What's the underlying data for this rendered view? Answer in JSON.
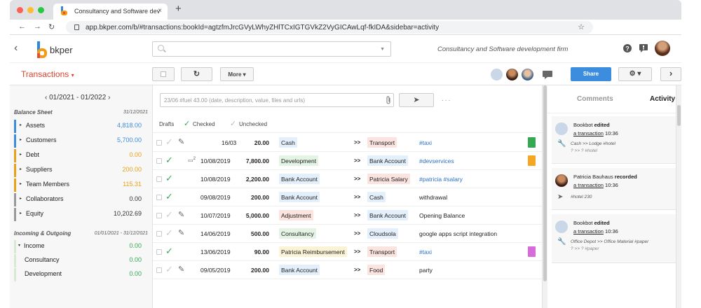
{
  "browser": {
    "tab_title": "Consultancy and Software dev",
    "tab_close": "×",
    "new_tab": "+",
    "url": "app.bkper.com/b/#transactions:bookId=agtzfmJrcGVyLWhyZHlTCxIGTGVkZ2VyGICAwLqf-fkIDA&sidebar=activity",
    "back": "←",
    "forward": "→",
    "reload": "↻",
    "bookmark": "☆"
  },
  "header": {
    "back_glyph": "‹",
    "logo_text": "bkper",
    "book_title": "Consultancy and Software development firm",
    "search_placeholder": ""
  },
  "toolbar": {
    "title": "Transactions",
    "caret": "▾",
    "refresh": "↻",
    "more_label": "More ▾",
    "share_label": "Share",
    "gear_label": "⚙ ▾",
    "next": "›"
  },
  "sidebar": {
    "period": "‹  01/2021 - 01/2022  ›",
    "balance_sheet": {
      "title": "Balance Sheet",
      "date": "31/12/2021"
    },
    "income_outgoing": {
      "title": "Incoming & Outgoing",
      "date": "01/01/2021 - 31/12/2021"
    },
    "accounts": [
      {
        "name": "Assets",
        "value": "4,818.00",
        "color": "#3c8dde",
        "val_color": "#3c8dde",
        "tri": "▸"
      },
      {
        "name": "Customers",
        "value": "5,700.00",
        "color": "#3c8dde",
        "val_color": "#3c8dde",
        "tri": "▸"
      },
      {
        "name": "Debt",
        "value": "0.00",
        "color": "#e8a21a",
        "val_color": "#e8a21a",
        "tri": "▸"
      },
      {
        "name": "Suppliers",
        "value": "200.00",
        "color": "#e8a21a",
        "val_color": "#e8a21a",
        "tri": "▸"
      },
      {
        "name": "Team Members",
        "value": "115.31",
        "color": "#e8a21a",
        "val_color": "#e8a21a",
        "tri": "▸"
      },
      {
        "name": "Collaborators",
        "value": "0.00",
        "color": "#999999",
        "val_color": "#333333",
        "tri": "▸"
      },
      {
        "name": "Equity",
        "value": "10,202.69",
        "color": "#999999",
        "val_color": "#333333",
        "tri": "▸"
      }
    ],
    "incoming": [
      {
        "name": "Income",
        "value": "0.00",
        "tri": "▾"
      },
      {
        "name": "Consultancy",
        "value": "0.00",
        "tri": ""
      },
      {
        "name": "Development",
        "value": "0.00",
        "tri": ""
      }
    ]
  },
  "main": {
    "new_tx_placeholder": "23/06 #fuel 43.00 (date, description, value, files and urls)",
    "send": "➤",
    "more_dots": "...",
    "filters": {
      "drafts": "Drafts",
      "checked": "Checked",
      "unchecked": "Unchecked"
    },
    "arrow": ">>",
    "rows": [
      {
        "date": "16/03",
        "amount": "20.00",
        "from": "Cash",
        "to": "Transport",
        "desc": "#taxi",
        "checked": false,
        "comment": "",
        "from_color": "#e3f0fb",
        "to_color": "#fbe3e0",
        "desc_link": true,
        "file": "#34a853"
      },
      {
        "date": "10/08/2019",
        "amount": "7,800.00",
        "from": "Development",
        "to": "Bank Account",
        "desc": "#devservices",
        "checked": true,
        "comment": "2",
        "from_color": "#e4f4e4",
        "to_color": "#e3f0fb",
        "desc_link": true,
        "file": "#f5a623"
      },
      {
        "date": "10/08/2019",
        "amount": "2,200.00",
        "from": "Bank Account",
        "to": "Patricia Salary",
        "desc": "#patricia #salary",
        "checked": true,
        "comment": "",
        "from_color": "#e3f0fb",
        "to_color": "#fbe3e0",
        "desc_link": true,
        "file": ""
      },
      {
        "date": "09/08/2019",
        "amount": "200.00",
        "from": "Bank Account",
        "to": "Cash",
        "desc": "withdrawal",
        "checked": true,
        "comment": "",
        "from_color": "#e3f0fb",
        "to_color": "#e3f0fb",
        "desc_link": false,
        "file": ""
      },
      {
        "date": "10/07/2019",
        "amount": "5,000.00",
        "from": "Adjustment",
        "to": "Bank Account",
        "desc": "Opening Balance",
        "checked": false,
        "comment": "",
        "from_color": "#fbe3e0",
        "to_color": "#e3f0fb",
        "desc_link": false,
        "file": ""
      },
      {
        "date": "14/06/2019",
        "amount": "500.00",
        "from": "Consultancy",
        "to": "Cloudsola",
        "desc": "google apps script integration",
        "checked": false,
        "comment": "",
        "from_color": "#e4f4e4",
        "to_color": "#e3f0fb",
        "desc_link": false,
        "file": ""
      },
      {
        "date": "13/06/2019",
        "amount": "90.00",
        "from": "Patricia Reimbursement",
        "to": "Transport",
        "desc": "#taxi",
        "checked": true,
        "comment": "",
        "from_color": "#fbf3d6",
        "to_color": "#fbe3e0",
        "desc_link": true,
        "file": "#d66bd9"
      },
      {
        "date": "09/05/2019",
        "amount": "200.00",
        "from": "Bank Account",
        "to": "Food",
        "desc": "party",
        "checked": false,
        "comment": "",
        "from_color": "#e3f0fb",
        "to_color": "#fbe3e0",
        "desc_link": false,
        "file": ""
      }
    ]
  },
  "right_panel": {
    "tab_comments": "Comments",
    "tab_activity": "Activity",
    "activities": [
      {
        "user": "Bookbot",
        "verb": "edited",
        "link": "a transaction",
        "time": "10:36",
        "line1": "Cash >> Lodge #hotel",
        "line2": "? >> ? #hotel",
        "icon": "🔧"
      },
      {
        "user": "Patricia Bauhaus",
        "verb": "recorded",
        "link": "a transaction",
        "time": "10:36",
        "line1": "#hotel 230",
        "line2": "",
        "icon": "➤"
      },
      {
        "user": "Bookbot",
        "verb": "edited",
        "link": "a transaction",
        "time": "10:36",
        "line1": "Office Depot >> Office Material #paper",
        "line2": "? >> ? #paper",
        "icon": "🔧"
      }
    ]
  }
}
